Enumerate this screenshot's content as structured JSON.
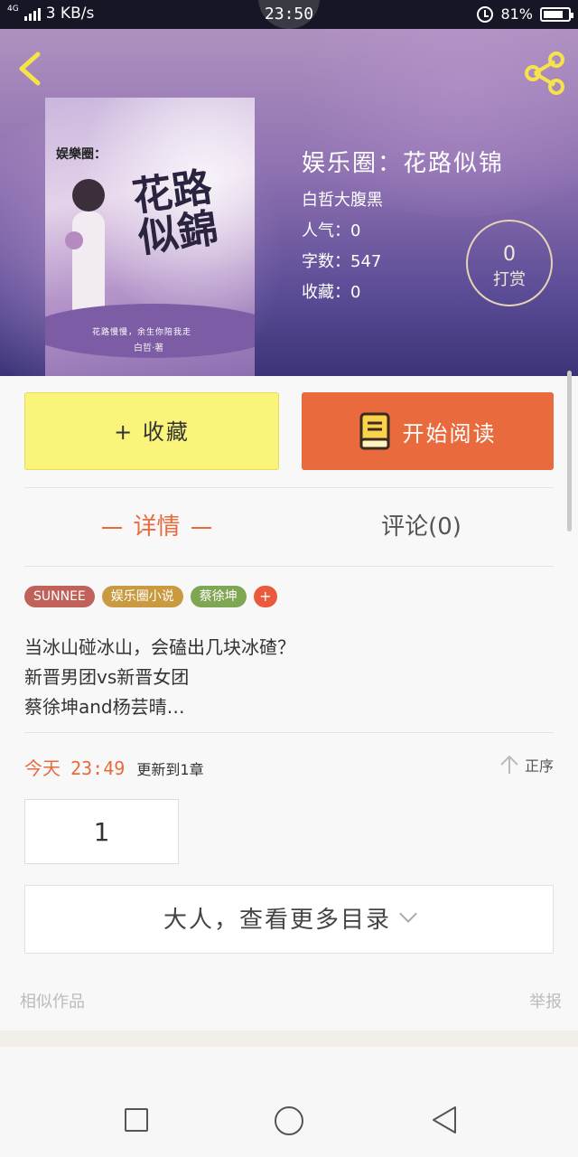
{
  "status_bar": {
    "network": "4G",
    "speed": "3 KB/s",
    "time": "23:50",
    "battery": "81%",
    "battery_level": 0.81
  },
  "book": {
    "title": "娱乐圈：花路似锦",
    "author": "白哲大腹黑",
    "popularity": "人气：0",
    "word_count": "字数：547",
    "favorites": "收藏：0",
    "tip_count": "0",
    "tip_label": "打赏"
  },
  "cover": {
    "series_text": "娱樂圈：",
    "title_text": "花路似錦",
    "tagline": "花路慢慢，余生你陪我走",
    "author_text": "白哲·著"
  },
  "actions": {
    "collect_label": "+ 收藏",
    "read_label": "开始阅读"
  },
  "tabs": {
    "detail": "详情",
    "comment": "评论(0)"
  },
  "tags": [
    {
      "label": "SUNNEE",
      "color": "#c0625a"
    },
    {
      "label": "娱乐圈小说",
      "color": "#c99a3f"
    },
    {
      "label": "蔡徐坤",
      "color": "#7fa653"
    },
    {
      "label": "+",
      "color": "#ea5a3c"
    }
  ],
  "description": [
    "当冰山碰冰山，会磕出几块冰碴？",
    "新晋男团vs新晋女团",
    "蔡徐坤and杨芸晴…"
  ],
  "update": {
    "day": "今天",
    "time": "23:49",
    "text": "更新到1章",
    "sort_label": "正序"
  },
  "chapters": [
    "1"
  ],
  "more_catalog": "大人，查看更多目录",
  "footer": {
    "similar": "相似作品",
    "report": "举报"
  },
  "colors": {
    "accent": "#e86a3d",
    "collect_button": "#fbf47a"
  }
}
